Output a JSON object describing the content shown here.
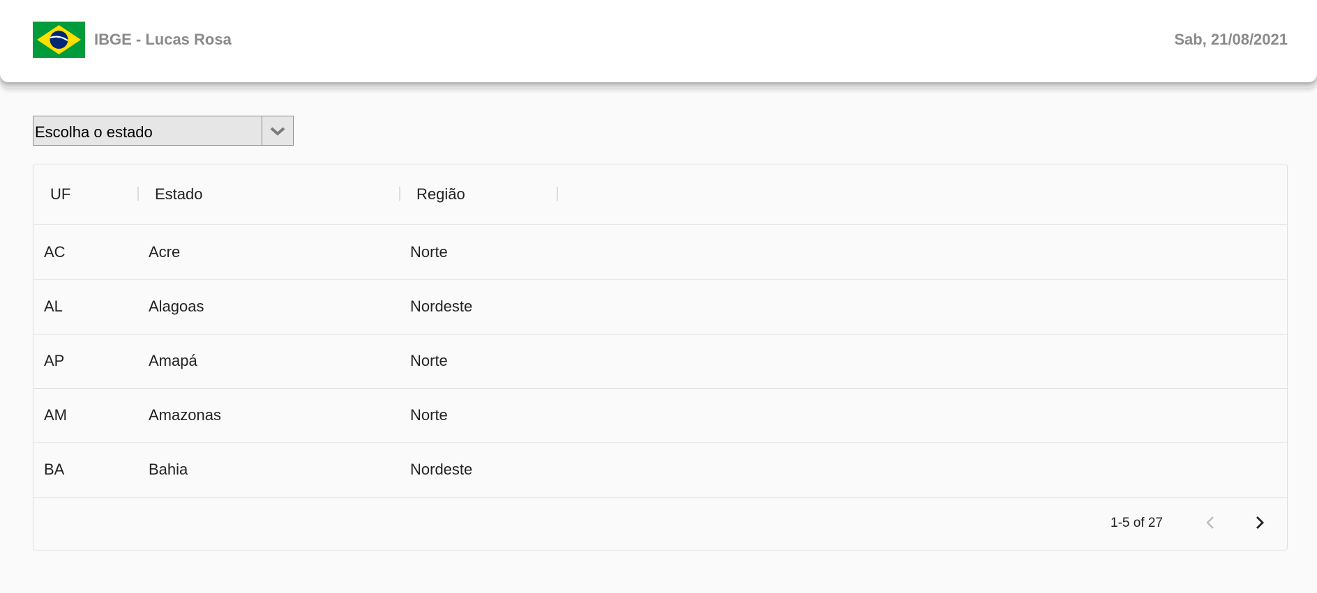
{
  "header": {
    "brand": "IBGE - Lucas Rosa",
    "date": "Sab, 21/08/2021",
    "flag_icon": "brazil-flag-icon"
  },
  "state_select": {
    "placeholder": "Escolha o estado",
    "icon": "chevron-down-icon"
  },
  "table": {
    "columns": [
      "UF",
      "Estado",
      "Região"
    ],
    "rows": [
      {
        "uf": "AC",
        "estado": "Acre",
        "regiao": "Norte"
      },
      {
        "uf": "AL",
        "estado": "Alagoas",
        "regiao": "Nordeste"
      },
      {
        "uf": "AP",
        "estado": "Amapá",
        "regiao": "Norte"
      },
      {
        "uf": "AM",
        "estado": "Amazonas",
        "regiao": "Norte"
      },
      {
        "uf": "BA",
        "estado": "Bahia",
        "regiao": "Nordeste"
      }
    ]
  },
  "pagination": {
    "label": "1-5 of 27",
    "prev_icon": "chevron-left-icon",
    "next_icon": "chevron-right-icon"
  },
  "colors": {
    "flag_green": "#009b3a",
    "flag_yellow": "#fedf00",
    "flag_blue": "#002776",
    "muted_text": "#8a8a8a"
  }
}
